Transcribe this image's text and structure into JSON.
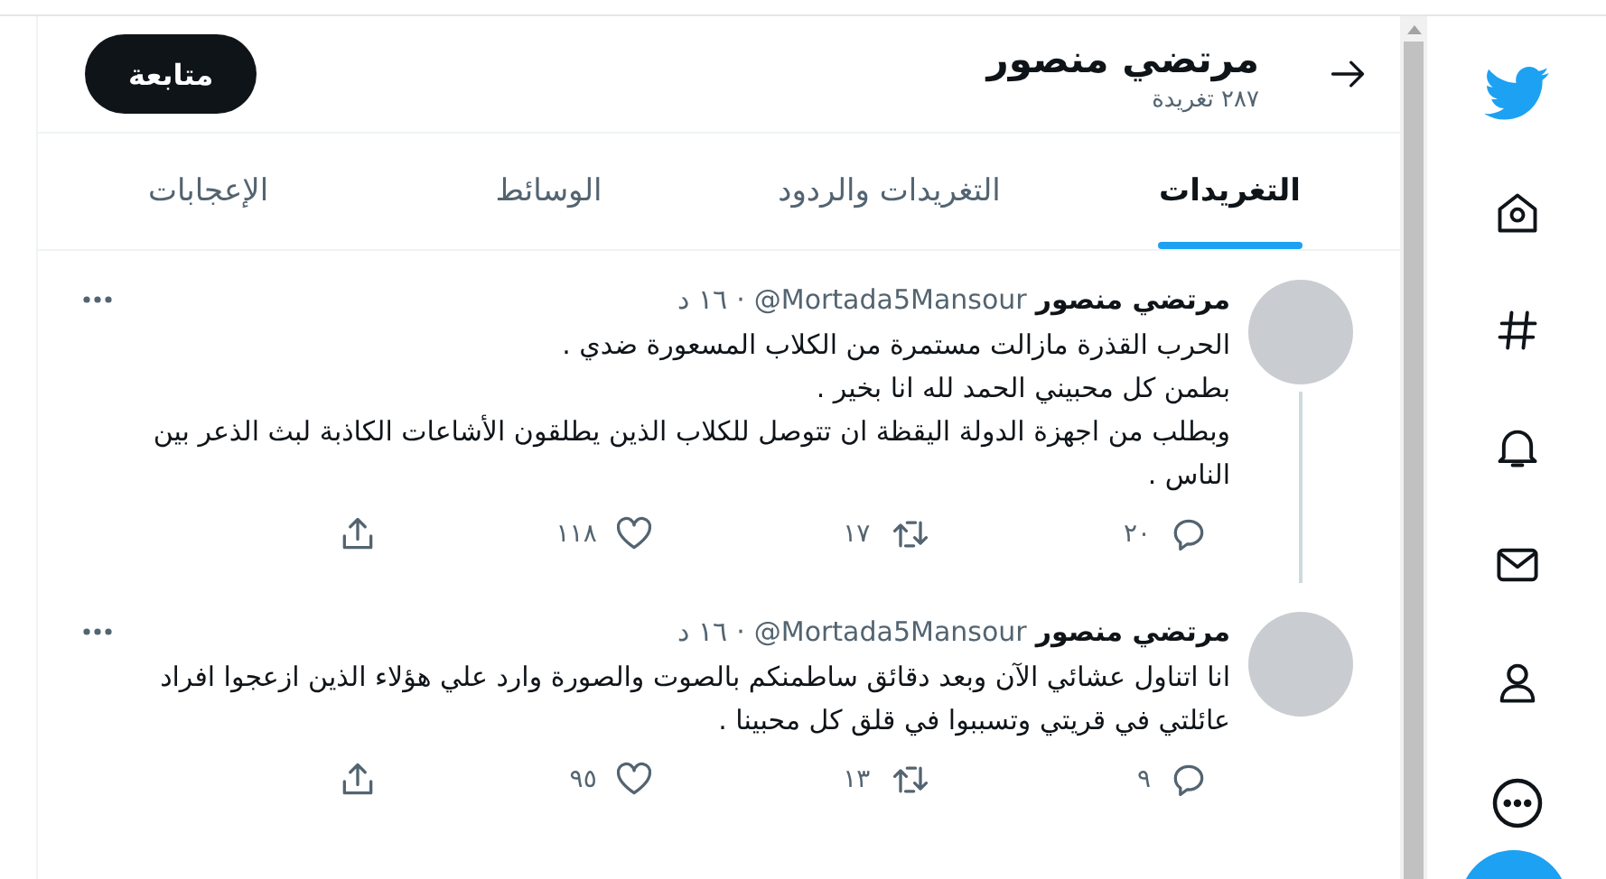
{
  "header": {
    "name": "مرتضي منصور",
    "tweet_count": "٢٨٧ تغريدة",
    "follow_label": "متابعة"
  },
  "tabs": [
    {
      "label": "التغريدات",
      "selected": true
    },
    {
      "label": "التغريدات والردود",
      "selected": false
    },
    {
      "label": "الوسائط",
      "selected": false
    },
    {
      "label": "الإعجابات",
      "selected": false
    }
  ],
  "tweets": [
    {
      "name": "مرتضي منصور",
      "handle": "@Mortada5Mansour",
      "separator": "·",
      "time": "١٦ د",
      "text": "الحرب القذرة مازالت مستمرة من الكلاب المسعورة ضدي .\nبطمن كل محبيني الحمد لله انا بخير .\nوبطلب من اجهزة الدولة اليقظة ان تتوصل للكلاب الذين يطلقون الأشاعات الكاذبة لبث الذعر بين الناس .",
      "replies": "٢٠",
      "retweets": "١٧",
      "likes": "١١٨"
    },
    {
      "name": "مرتضي منصور",
      "handle": "@Mortada5Mansour",
      "separator": "·",
      "time": "١٦ د",
      "text": "انا اتناول عشائي الآن وبعد دقائق ساطمنكم بالصوت والصورة وارد علي هؤلاء الذين ازعجوا افراد عائلتي في قريتي وتسببوا في قلق كل محبينا .",
      "replies": "٩",
      "retweets": "١٣",
      "likes": "٩٥"
    }
  ]
}
